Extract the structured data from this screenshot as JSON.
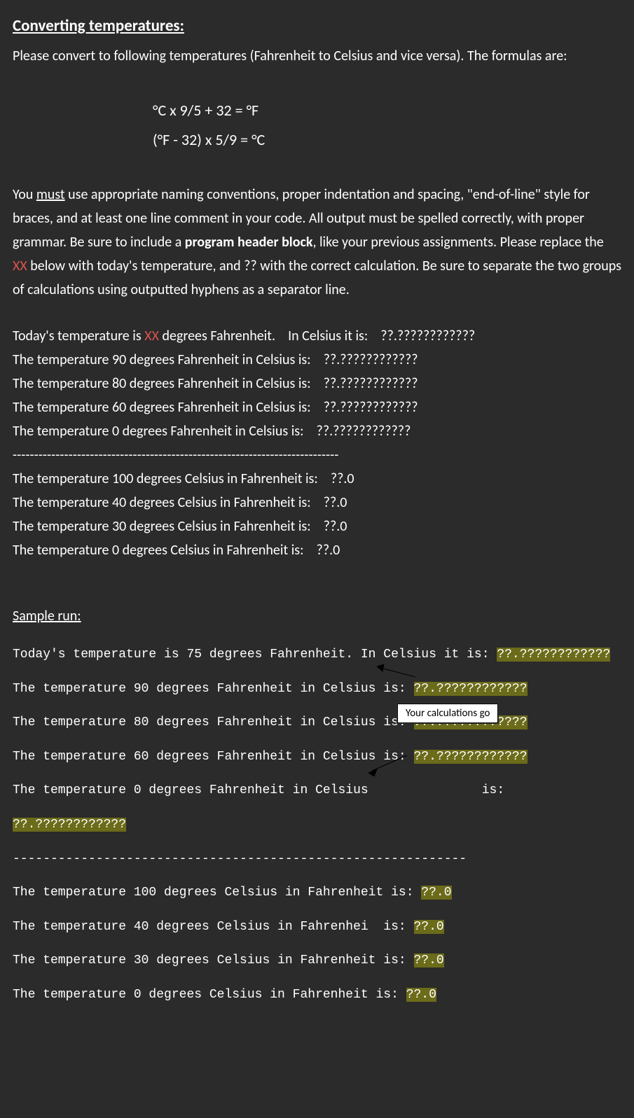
{
  "heading": "Converting temperatures:",
  "para1": "Please convert to following temperatures (Fahrenheit to Celsius and vice versa).    The formulas are:",
  "formula1": "°C  x  9/5 + 32 = °F",
  "formula2": "(°F  -  32)  x  5/9 = °C",
  "para2a": "You ",
  "para2_must": "must",
  "para2b": " use appropriate naming conventions, proper indentation and spacing, \"end-of-line\" style for braces, and at least one line comment in your code.    All output must be spelled correctly, with proper grammar.    Be sure to include a ",
  "para2_phb": "program header block",
  "para2c": ", like your previous assignments.    Please replace the ",
  "para2_xx": "XX",
  "para2d": " below with today's temperature, and ?? with the correct calculation.    Be sure to separate the two groups of calculations using outputted hyphens as a separator line.",
  "out": {
    "l1a": "Today's temperature is ",
    "l1xx": "XX",
    "l1b": " degrees Fahrenheit.    In Celsius it is:    ??.????????????",
    "l2": "The temperature 90 degrees Fahrenheit in Celsius is:    ??.????????????",
    "l3": "The temperature 80 degrees Fahrenheit in Celsius is:    ??.????????????",
    "l4": "The temperature 60 degrees Fahrenheit in Celsius is:    ??.????????????",
    "l5": "The temperature 0 degrees Fahrenheit in Celsius is:    ??.????????????",
    "sep": "----------------------------------------------------------------------------",
    "l6": "The temperature 100 degrees Celsius in Fahrenheit is:    ??.0",
    "l7": "The temperature 40 degrees Celsius in Fahrenheit is:    ??.0",
    "l8": "The temperature 30 degrees Celsius in Fahrenheit is:    ??.0",
    "l9": "The temperature 0 degrees Celsius in Fahrenheit is:    ??.0"
  },
  "sample_heading": "Sample run:",
  "sample": {
    "l1a": "Today's temperature is 75 degrees Fahrenheit. In Celsius it is: ",
    "l1h": "??.????????????",
    "l2a": "The temperature 90 degrees Fahrenheit in Celsius is: ",
    "l2h": "??.????????????",
    "l3a": "The temperature 80 degrees Fahrenheit in Celsius is: ",
    "l3h": "??.????????????",
    "l4a": "The temperature 60 degrees Fahrenheit in Celsius is: ",
    "l4h": "??.????????????",
    "l5a": "The temperature 0 degrees Fahrenheit in Celsius               is: ",
    "l5h": "??.????????????",
    "sep": "------------------------------------------------------------",
    "l6a": "The temperature 100 degrees Celsius in Fahrenheit is: ",
    "l6h": "??.0",
    "l7a": "The temperature 40 degrees Celsius in Fahrenhei  is: ",
    "l7h": "??.0",
    "l8a": "The temperature 30 degrees Celsius in Fahrenheit is: ",
    "l8h": "??.0",
    "l9a": "The temperature 0 degrees Celsius in Fahrenheit is: ",
    "l9h": "??.0"
  },
  "callout": "Your calculations go"
}
